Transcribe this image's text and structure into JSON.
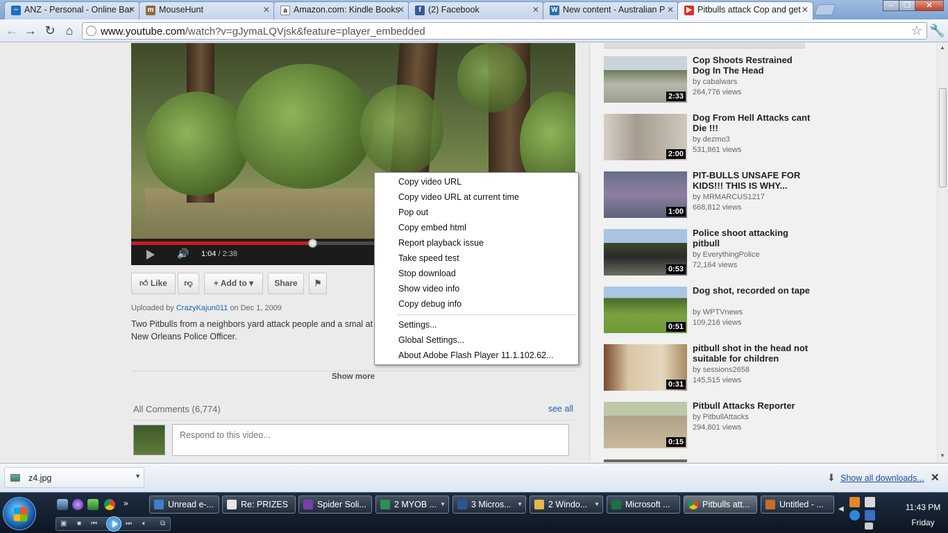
{
  "browser": {
    "tabs": [
      {
        "title": "ANZ - Personal - Online Bar",
        "icon": "anz-icon",
        "color": "#1f6fc0"
      },
      {
        "title": "MouseHunt",
        "icon": "mousehunt-icon",
        "color": "#8a6c3c"
      },
      {
        "title": "Amazon.com: Kindle Books",
        "icon": "amazon-icon",
        "color": "#222222"
      },
      {
        "title": "(2) Facebook",
        "icon": "facebook-icon",
        "color": "#3b5998"
      },
      {
        "title": "New content - Australian P",
        "icon": "wordpress-icon",
        "color": "#2a6fa6"
      },
      {
        "title": "Pitbulls attack Cop and get",
        "icon": "youtube-icon",
        "color": "#e52d27"
      }
    ],
    "url_host": "www.youtube.com",
    "url_path": "/watch?v=gJymaLQVjsk&feature=player_embedded"
  },
  "player": {
    "time_current": "1:04",
    "time_total": "/ 2:38",
    "progress_fraction": 0.41
  },
  "actions": {
    "like": "Like",
    "add_to": "Add to",
    "share": "Share"
  },
  "info": {
    "uploaded_by_prefix": "Uploaded by",
    "uploader": "CrazyKajun011",
    "uploaded_on": "on Dec 1, 2009",
    "description": "Two Pitbulls from a neighbors yard attack people and a smal at a New Orleans Police Officer.",
    "show_more": "Show more"
  },
  "comments": {
    "title": "All Comments (6,774)",
    "see_all": "see all",
    "placeholder": "Respond to this video..."
  },
  "context_menu": {
    "items": [
      "Copy video URL",
      "Copy video URL at current time",
      "Pop out",
      "Copy embed html",
      "Report playback issue",
      "Take speed test",
      "Stop download",
      "Show video info",
      "Copy debug info",
      "Settings...",
      "Global Settings...",
      "About Adobe Flash Player 11.1.102.62..."
    ]
  },
  "related": [
    {
      "title": "Cop Shoots Restrained Dog In The Head",
      "by": "by cabalwars",
      "views": "264,776 views",
      "duration": "2:33"
    },
    {
      "title": "Dog From Hell Attacks cant Die !!!",
      "by": "by dezmo3",
      "views": "531,861 views",
      "duration": "2:00"
    },
    {
      "title": "PIT-BULLS UNSAFE FOR KIDS!!! THIS IS WHY...",
      "by": "by MRMARCUS1217",
      "views": "668,812 views",
      "duration": "1:00"
    },
    {
      "title": "Police shoot attacking pitbull",
      "by": "by EverythingPolice",
      "views": "72,164 views",
      "duration": "0:53"
    },
    {
      "title": "Dog shot, recorded on tape",
      "by": "by WPTVnews",
      "views": "109,216 views",
      "duration": "0:51"
    },
    {
      "title": "pitbull shot in the head not suitable for children",
      "by": "by sessions2658",
      "views": "145,515 views",
      "duration": "0:31"
    },
    {
      "title": "Pitbull Attacks Reporter",
      "by": "by PitbullAttacks",
      "views": "294,801 views",
      "duration": "0:15"
    }
  ],
  "downloads": {
    "file": "z4.jpg",
    "show_all": "Show all downloads..."
  },
  "taskbar": {
    "buttons": [
      {
        "label": "Unread e-...",
        "color": "#3f7fc8"
      },
      {
        "label": "Re: PRIZES",
        "color": "#e6e6e6"
      },
      {
        "label": "Spider Soli...",
        "color": "#7a3fa8"
      },
      {
        "label": "2 MYOB ...",
        "color": "#2b8f5a"
      },
      {
        "label": "3 Micros...",
        "color": "#2b5797"
      },
      {
        "label": "2 Windo...",
        "color": "#e3b84a"
      },
      {
        "label": "Microsoft ...",
        "color": "#1e7145"
      },
      {
        "label": "Pitbulls att...",
        "color": "#e04a2a"
      },
      {
        "label": "Untitled - ...",
        "color": "#c86a2a"
      }
    ],
    "time": "11:43 PM",
    "day": "Friday"
  }
}
